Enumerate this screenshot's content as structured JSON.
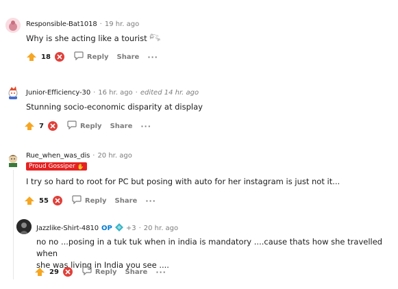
{
  "comments": [
    {
      "username": "Responsible-Bat1018",
      "time": "19 hr. ago",
      "text": "Why is she acting like a tourist 𓀐",
      "votes": "18",
      "reply_label": "Reply",
      "share_label": "Share",
      "more_label": "···"
    },
    {
      "username": "Junior-Efficiency-30",
      "time": "16 hr. ago",
      "edited": "edited 14 hr. ago",
      "text": "Stunning socio-economic disparity at display",
      "votes": "7",
      "reply_label": "Reply",
      "share_label": "Share",
      "more_label": "···"
    },
    {
      "username": "Rue_when_was_dis",
      "time": "20 hr. ago",
      "flair": "Proud Gossiper",
      "text": "I try so hard to root for PC but posing with auto for her instagram is just not it...",
      "votes": "55",
      "reply_label": "Reply",
      "share_label": "Share",
      "more_label": "···"
    },
    {
      "username": "Jazzlike-Shirt-4810",
      "op_label": "OP",
      "badge_count": "+3",
      "time": "20 hr. ago",
      "text_line1": "no no ...posing in a tuk tuk when in india is mandatory ....cause thats how she travelled when",
      "text_line2": "she was living in India you see ....",
      "votes": "29",
      "reply_label": "Reply",
      "share_label": "Share",
      "more_label": "···"
    }
  ],
  "dot": "·",
  "colors": {
    "upvote": "#f5a623",
    "downvote": "#e0403a",
    "flair": "#e52222",
    "op": "#0079d3"
  }
}
